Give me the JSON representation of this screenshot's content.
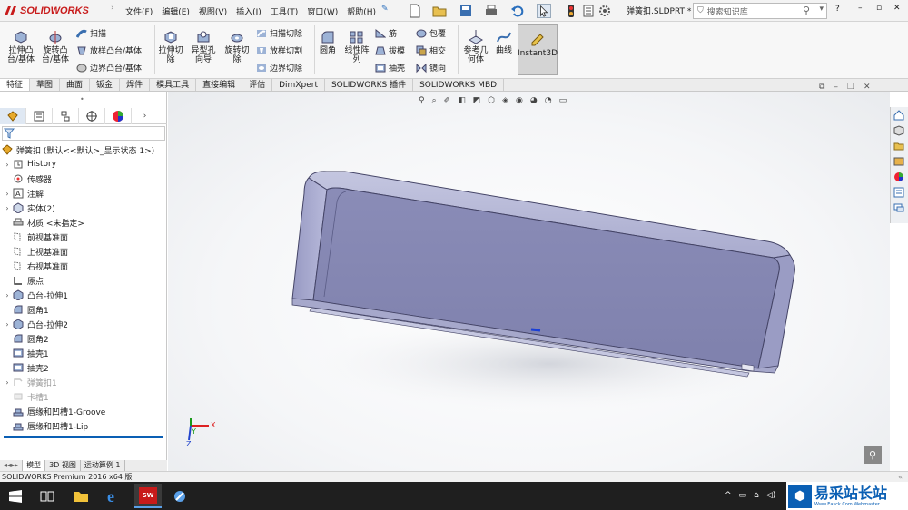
{
  "app": {
    "logo_text": "SOLIDWORKS",
    "file_name": "弹簧扣.SLDPRT *",
    "search_placeholder": "搜索知识库",
    "help": "?",
    "menus": [
      "文件(F)",
      "编辑(E)",
      "视图(V)",
      "插入(I)",
      "工具(T)",
      "窗口(W)",
      "帮助(H)"
    ]
  },
  "ribbon": {
    "extrude_boss": "拉伸凸\n台/基体",
    "revolve_boss": "旋转凸\n台/基体",
    "sweep": "扫描",
    "loft": "放样凸台/基体",
    "boundary": "边界凸台/基体",
    "extrude_cut": "拉伸切\n除",
    "hole_wizard": "异型孔\n向导",
    "revolve_cut": "旋转切\n除",
    "sweep_cut": "扫描切除",
    "loft_cut": "放样切割",
    "boundary_cut": "边界切除",
    "fillet": "圆角",
    "linear_pattern": "线性阵\n列",
    "rib": "筋",
    "draft": "拔模",
    "shell": "抽壳",
    "wrap": "包覆",
    "intersect": "相交",
    "mirror": "镜向",
    "ref_geometry": "参考几\n何体",
    "curves": "曲线",
    "instant3d": "Instant3D"
  },
  "tabs": [
    "特征",
    "草图",
    "曲面",
    "钣金",
    "焊件",
    "模具工具",
    "直接编辑",
    "评估",
    "DimXpert",
    "SOLIDWORKS 插件",
    "SOLIDWORKS MBD"
  ],
  "tree": {
    "root": "弹簧扣 (默认<<默认>_显示状态 1>)",
    "items": [
      {
        "label": "History",
        "icon": "history-icon",
        "exp": "›",
        "dim": false
      },
      {
        "label": "传感器",
        "icon": "sensor-icon",
        "exp": "",
        "dim": false
      },
      {
        "label": "注解",
        "icon": "annotation-icon",
        "exp": "›",
        "dim": false
      },
      {
        "label": "实体(2)",
        "icon": "solid-bodies-icon",
        "exp": "›",
        "dim": false
      },
      {
        "label": "材质 <未指定>",
        "icon": "material-icon",
        "exp": "",
        "dim": false
      },
      {
        "label": "前视基准面",
        "icon": "plane-icon",
        "exp": "",
        "dim": false
      },
      {
        "label": "上视基准面",
        "icon": "plane-icon",
        "exp": "",
        "dim": false
      },
      {
        "label": "右视基准面",
        "icon": "plane-icon",
        "exp": "",
        "dim": false
      },
      {
        "label": "原点",
        "icon": "origin-icon",
        "exp": "",
        "dim": false
      },
      {
        "label": "凸台-拉伸1",
        "icon": "extrude-icon",
        "exp": "›",
        "dim": false
      },
      {
        "label": "圆角1",
        "icon": "fillet-icon",
        "exp": "",
        "dim": false
      },
      {
        "label": "凸台-拉伸2",
        "icon": "extrude-icon",
        "exp": "›",
        "dim": false
      },
      {
        "label": "圆角2",
        "icon": "fillet-icon",
        "exp": "",
        "dim": false
      },
      {
        "label": "抽壳1",
        "icon": "shell-icon",
        "exp": "",
        "dim": false
      },
      {
        "label": "抽壳2",
        "icon": "shell-icon",
        "exp": "",
        "dim": false
      },
      {
        "label": "弹簧扣1",
        "icon": "snap-hook-icon",
        "exp": "›",
        "dim": true
      },
      {
        "label": "卡槽1",
        "icon": "snap-hook-groove-icon",
        "exp": "",
        "dim": true
      },
      {
        "label": "唇缘和凹槽1-Groove",
        "icon": "lip-groove-icon",
        "exp": "",
        "dim": false
      },
      {
        "label": "唇缘和凹槽1-Lip",
        "icon": "lip-groove-icon",
        "exp": "",
        "dim": false
      }
    ]
  },
  "bottom_tabs": [
    "模型",
    "3D 视图",
    "运动算例 1"
  ],
  "status_text": "SOLIDWORKS Premium 2016 x64 版",
  "watermark_text": "易采站长站",
  "watermark_sub": "Www.Easck.Com Webmaster",
  "triad": {
    "x": "X",
    "y": "Y",
    "z": "Z"
  },
  "colors": {
    "accent": "#0a5fb4",
    "brand_red": "#c81b1b",
    "part": "#8e90b8"
  }
}
